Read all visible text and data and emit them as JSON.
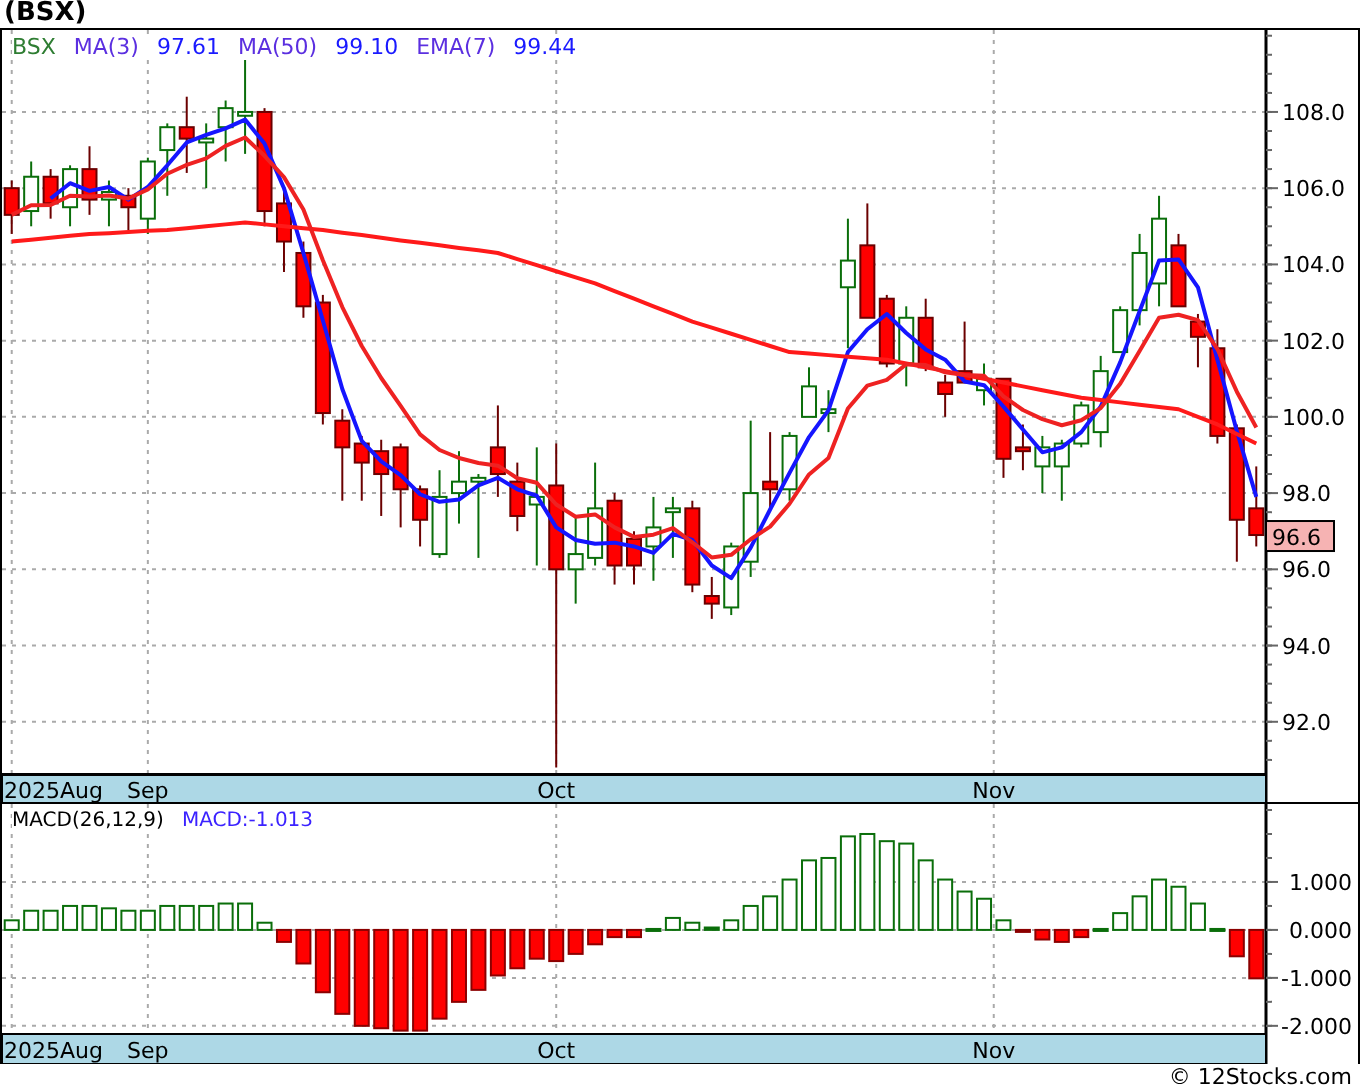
{
  "title": "(BSX)",
  "price_panel": {
    "symbol": "BSX",
    "legend_values": [
      "97.61",
      "99.10",
      "99.44"
    ],
    "last_price": "96.6",
    "date_labels": [
      "2025Aug",
      "Sep",
      "Oct",
      "Nov"
    ],
    "chart_data": {
      "type": "candlestick",
      "grid": true,
      "ylim": [
        90.63,
        110.15
      ],
      "ohlc": [
        [
          106.0,
          106.2,
          104.8,
          105.3
        ],
        [
          105.4,
          106.7,
          105.0,
          106.3
        ],
        [
          106.3,
          106.5,
          105.2,
          105.6
        ],
        [
          105.5,
          106.6,
          105.0,
          106.5
        ],
        [
          106.5,
          107.1,
          105.3,
          105.7
        ],
        [
          105.7,
          106.2,
          105.0,
          105.9
        ],
        [
          105.8,
          106.0,
          104.9,
          105.5
        ],
        [
          105.2,
          106.8,
          104.8,
          106.7
        ],
        [
          107.0,
          107.7,
          105.8,
          107.6
        ],
        [
          107.6,
          108.4,
          106.4,
          107.3
        ],
        [
          107.2,
          107.7,
          106.0,
          107.3
        ],
        [
          107.6,
          108.3,
          106.7,
          108.1
        ],
        [
          107.9,
          109.4,
          106.9,
          108.0
        ],
        [
          108.0,
          108.1,
          105.0,
          105.4
        ],
        [
          105.6,
          106.0,
          103.8,
          104.6
        ],
        [
          104.3,
          104.6,
          102.6,
          102.9
        ],
        [
          103.0,
          103.2,
          99.8,
          100.1
        ],
        [
          99.9,
          100.2,
          97.8,
          99.2
        ],
        [
          99.3,
          99.5,
          97.8,
          98.8
        ],
        [
          99.1,
          99.4,
          97.4,
          98.5
        ],
        [
          99.2,
          99.3,
          97.1,
          98.1
        ],
        [
          98.1,
          98.2,
          96.6,
          97.3
        ],
        [
          96.4,
          98.6,
          96.3,
          97.9
        ],
        [
          98.0,
          99.1,
          97.2,
          98.3
        ],
        [
          98.3,
          98.5,
          96.3,
          98.4
        ],
        [
          99.2,
          100.3,
          97.9,
          98.5
        ],
        [
          98.3,
          98.8,
          97.0,
          97.4
        ],
        [
          97.7,
          99.2,
          96.1,
          97.9
        ],
        [
          98.2,
          99.3,
          90.8,
          96.0
        ],
        [
          96.0,
          97.4,
          95.1,
          96.4
        ],
        [
          96.3,
          98.8,
          96.1,
          97.6
        ],
        [
          97.8,
          98.0,
          95.6,
          96.1
        ],
        [
          96.8,
          97.0,
          95.6,
          96.1
        ],
        [
          96.6,
          97.9,
          95.7,
          97.1
        ],
        [
          97.5,
          97.9,
          96.3,
          97.6
        ],
        [
          97.6,
          97.8,
          95.4,
          95.6
        ],
        [
          95.3,
          95.8,
          94.7,
          95.1
        ],
        [
          95.0,
          96.7,
          94.8,
          96.6
        ],
        [
          96.2,
          99.9,
          95.8,
          98.0
        ],
        [
          98.3,
          99.6,
          97.6,
          98.1
        ],
        [
          98.1,
          99.6,
          97.8,
          99.5
        ],
        [
          100.0,
          101.3,
          100.0,
          100.8
        ],
        [
          100.1,
          100.7,
          99.6,
          100.2
        ],
        [
          103.4,
          105.2,
          101.8,
          104.1
        ],
        [
          104.5,
          105.6,
          102.6,
          102.6
        ],
        [
          103.1,
          103.2,
          101.3,
          101.4
        ],
        [
          101.4,
          102.9,
          100.8,
          102.6
        ],
        [
          102.6,
          103.1,
          101.2,
          101.3
        ],
        [
          100.9,
          101.1,
          100.0,
          100.6
        ],
        [
          101.2,
          102.5,
          100.9,
          100.9
        ],
        [
          100.7,
          101.4,
          100.3,
          101.0
        ],
        [
          101.0,
          101.0,
          98.4,
          98.9
        ],
        [
          99.2,
          99.8,
          98.6,
          99.1
        ],
        [
          98.7,
          99.5,
          98.0,
          99.2
        ],
        [
          98.7,
          99.4,
          97.8,
          99.3
        ],
        [
          99.3,
          100.4,
          99.2,
          100.3
        ],
        [
          99.6,
          101.6,
          99.2,
          101.2
        ],
        [
          101.7,
          102.9,
          101.7,
          102.8
        ],
        [
          102.8,
          104.8,
          102.4,
          104.3
        ],
        [
          103.5,
          105.8,
          102.9,
          105.2
        ],
        [
          104.5,
          104.8,
          102.9,
          102.9
        ],
        [
          102.5,
          102.7,
          101.3,
          102.1
        ],
        [
          101.8,
          102.3,
          99.3,
          99.5
        ],
        [
          99.7,
          99.8,
          96.2,
          97.3
        ],
        [
          97.6,
          98.7,
          96.6,
          96.9
        ]
      ],
      "yticks": [
        {
          "value": 92,
          "label": "92.0"
        },
        {
          "value": 94,
          "label": "94.0"
        },
        {
          "value": 96,
          "label": "96.0"
        },
        {
          "value": 98,
          "label": "98.0"
        },
        {
          "value": 100,
          "label": "100.0"
        },
        {
          "value": 102,
          "label": "102.0"
        },
        {
          "value": 104,
          "label": "104.0"
        },
        {
          "value": 106,
          "label": "106.0"
        },
        {
          "value": 108,
          "label": "108.0"
        }
      ]
    },
    "moving_averages": {
      "chart_data": {
        "type": "line",
        "ylim": [
          90.63,
          110.15
        ],
        "series": [
          {
            "name": "MA(3)",
            "color": "#1515ff",
            "values": [
              null,
              null,
              105.73,
              106.13,
              105.93,
              106.03,
              105.7,
              106.03,
              106.6,
              107.2,
              107.4,
              107.57,
              107.8,
              107.17,
              106.0,
              104.3,
              102.53,
              100.73,
              99.37,
              98.83,
              98.47,
              97.97,
              97.77,
              97.83,
              98.2,
              98.4,
              98.1,
              97.93,
              97.1,
              96.77,
              96.67,
              96.7,
              96.6,
              96.43,
              96.93,
              96.77,
              96.1,
              95.77,
              96.57,
              97.57,
              98.53,
              99.47,
              100.17,
              101.7,
              102.3,
              102.7,
              102.2,
              101.77,
              101.5,
              100.93,
              100.83,
              100.27,
              99.67,
              99.07,
              99.2,
              99.6,
              100.27,
              101.43,
              102.77,
              104.1,
              104.13,
              103.4,
              101.5,
              99.63,
              97.9
            ]
          },
          {
            "name": "MA(50)",
            "color": "#ff1a1a",
            "values": [
              104.6,
              104.65,
              104.7,
              104.75,
              104.8,
              104.82,
              104.85,
              104.88,
              104.9,
              104.95,
              105.0,
              105.05,
              105.1,
              105.05,
              105.0,
              104.95,
              104.9,
              104.83,
              104.77,
              104.7,
              104.63,
              104.57,
              104.5,
              104.43,
              104.37,
              104.3,
              104.14,
              103.98,
              103.82,
              103.66,
              103.5,
              103.3,
              103.1,
              102.9,
              102.7,
              102.5,
              102.34,
              102.18,
              102.02,
              101.86,
              101.7,
              101.66,
              101.62,
              101.58,
              101.54,
              101.5,
              101.4,
              101.3,
              101.2,
              101.1,
              101.0,
              100.9,
              100.8,
              100.7,
              100.6,
              100.5,
              100.44,
              100.38,
              100.32,
              100.26,
              100.2,
              100.0,
              99.8,
              99.55,
              99.3
            ]
          },
          {
            "name": "EMA(7)",
            "color": "#ee2222",
            "values": [
              105.3,
              105.55,
              105.56,
              105.8,
              105.78,
              105.81,
              105.73,
              105.97,
              106.38,
              106.61,
              106.78,
              107.11,
              107.33,
              106.85,
              106.29,
              105.44,
              104.11,
              102.88,
              101.86,
              101.02,
              100.29,
              99.54,
              99.13,
              98.92,
              98.79,
              98.72,
              98.39,
              98.27,
              97.7,
              97.38,
              97.44,
              97.1,
              96.85,
              96.91,
              97.08,
              96.71,
              96.31,
              96.38,
              96.79,
              97.12,
              97.72,
              98.49,
              98.92,
              100.22,
              100.82,
              100.97,
              101.38,
              101.36,
              101.17,
              101.1,
              101.08,
              100.54,
              100.18,
              99.94,
              99.78,
              99.91,
              100.23,
              100.87,
              101.73,
              102.6,
              102.68,
              102.54,
              101.78,
              100.66,
              99.72
            ]
          }
        ]
      }
    }
  },
  "macd_panel": {
    "legend": [
      {
        "text": "MACD(26,12,9)",
        "kind": "name"
      },
      {
        "text": "MACD:-1.013",
        "kind": "value"
      }
    ],
    "date_labels": [
      "2025Aug",
      "Sep",
      "Oct",
      "Nov"
    ],
    "chart_data": {
      "type": "bar",
      "grid": true,
      "ylim": [
        -2.17,
        2.625
      ],
      "series": [
        {
          "values": [
            0.2,
            0.4,
            0.4,
            0.5,
            0.5,
            0.45,
            0.4,
            0.4,
            0.5,
            0.5,
            0.5,
            0.55,
            0.55,
            0.15,
            -0.25,
            -0.7,
            -1.3,
            -1.75,
            -2.0,
            -2.05,
            -2.1,
            -2.1,
            -1.85,
            -1.5,
            -1.25,
            -0.95,
            -0.8,
            -0.6,
            -0.65,
            -0.5,
            -0.3,
            -0.15,
            -0.15,
            0.02,
            0.25,
            0.15,
            0.05,
            0.2,
            0.5,
            0.7,
            1.05,
            1.45,
            1.5,
            1.95,
            2.0,
            1.85,
            1.8,
            1.45,
            1.05,
            0.8,
            0.65,
            0.2,
            -0.02,
            -0.2,
            -0.25,
            -0.15,
            0.02,
            0.35,
            0.7,
            1.05,
            0.9,
            0.55,
            0.02,
            -0.55,
            -1.01
          ]
        }
      ],
      "yticks": [
        {
          "value": 1,
          "label": "1.000"
        },
        {
          "value": 0,
          "label": "0.000"
        },
        {
          "value": -1,
          "label": "-1.000"
        },
        {
          "value": -2,
          "label": "-2.000"
        }
      ]
    }
  },
  "footer": "© 12Stocks.com"
}
